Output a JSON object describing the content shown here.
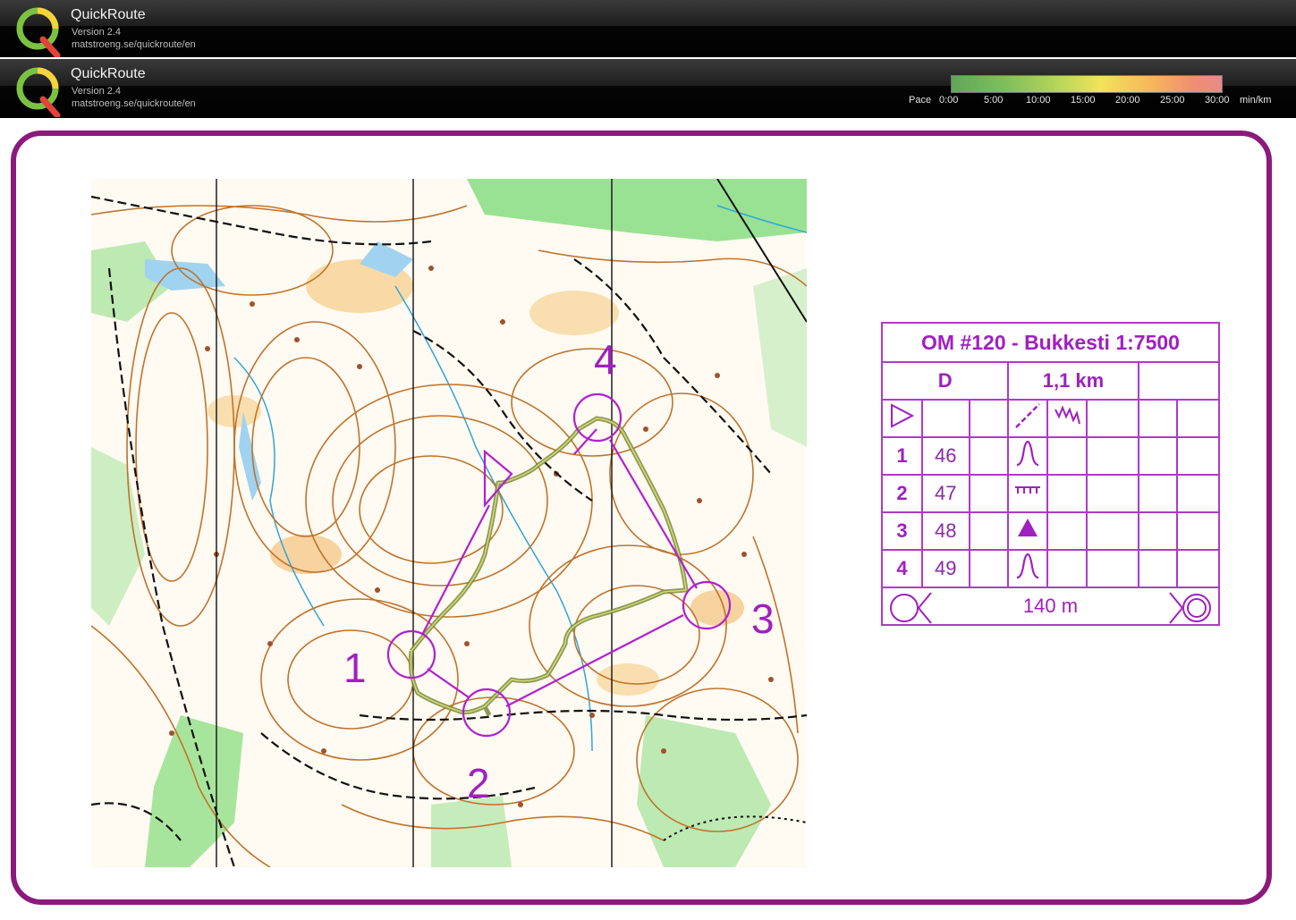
{
  "app_bars": [
    {
      "title": "QuickRoute",
      "version": "Version 2.4",
      "url": "matstroeng.se/quickroute/en"
    },
    {
      "title": "QuickRoute",
      "version": "Version 2.4",
      "url": "matstroeng.se/quickroute/en"
    }
  ],
  "pace_legend": {
    "label": "Pace",
    "ticks": [
      "0:00",
      "5:00",
      "10:00",
      "15:00",
      "20:00",
      "25:00",
      "30:00"
    ],
    "unit": "min/km",
    "colors": [
      "#5fa75a",
      "#b9d65a",
      "#f1e35a",
      "#f7b45b",
      "#e98a8a"
    ]
  },
  "map": {
    "course_color": "#a020c0",
    "route_color": "#7a8a3a",
    "controls": [
      {
        "number": "1"
      },
      {
        "number": "2"
      },
      {
        "number": "3"
      },
      {
        "number": "4"
      }
    ]
  },
  "control_descriptions": {
    "title": "OM #120 - Bukkesti 1:7500",
    "class": "D",
    "length": "1,1 km",
    "rows": [
      {
        "num": "1",
        "code": "46",
        "feature": "knoll"
      },
      {
        "num": "2",
        "code": "47",
        "feature": "earth bank"
      },
      {
        "num": "3",
        "code": "48",
        "feature": "boulder"
      },
      {
        "num": "4",
        "code": "49",
        "feature": "knoll"
      }
    ],
    "finish_distance": "140 m"
  },
  "colors": {
    "frame": "#8b1a7c",
    "accent": "#a020c0"
  }
}
